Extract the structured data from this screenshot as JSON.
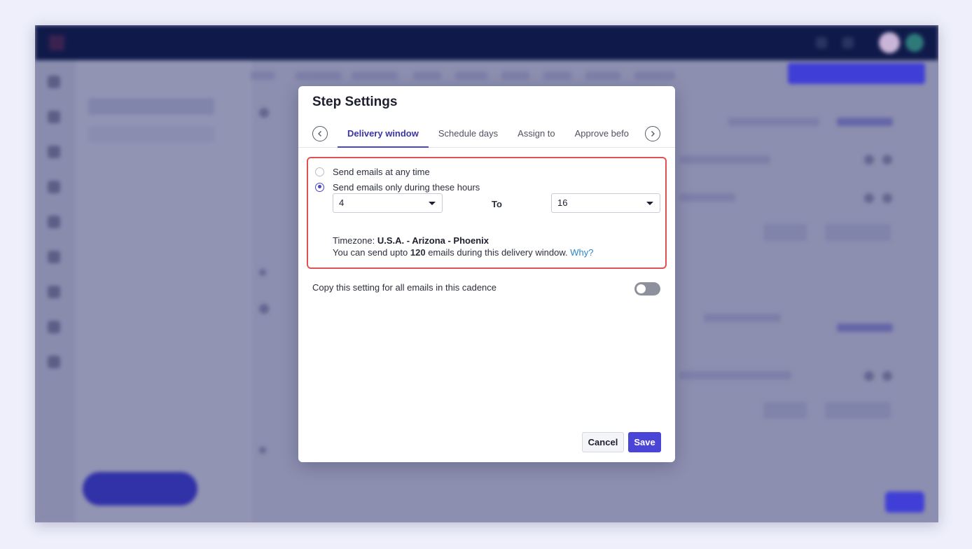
{
  "modal": {
    "title": "Step Settings",
    "tabs": [
      {
        "label": "Delivery window",
        "active": true
      },
      {
        "label": "Schedule days",
        "active": false
      },
      {
        "label": "Assign to",
        "active": false
      },
      {
        "label": "Approve befo",
        "active": false
      }
    ],
    "delivery": {
      "option_any_time": "Send emails at any time",
      "option_hours": "Send emails only during these hours",
      "selected_option": "hours",
      "from_value": "4",
      "to_label": "To",
      "to_value": "16",
      "timezone_label": "Timezone:",
      "timezone_value": "U.S.A. - Arizona - Phoenix",
      "limit_prefix": "You can send upto",
      "limit_count": "120",
      "limit_suffix": "emails during this delivery window.",
      "why_link": "Why?"
    },
    "copy_setting_label": "Copy this setting for all emails in this cadence",
    "copy_setting_enabled": false,
    "cancel_label": "Cancel",
    "save_label": "Save"
  },
  "colors": {
    "accent": "#4b45d6",
    "highlight_border": "#e05252",
    "link": "#2a86c8",
    "backdrop": "#8d8fb0"
  }
}
